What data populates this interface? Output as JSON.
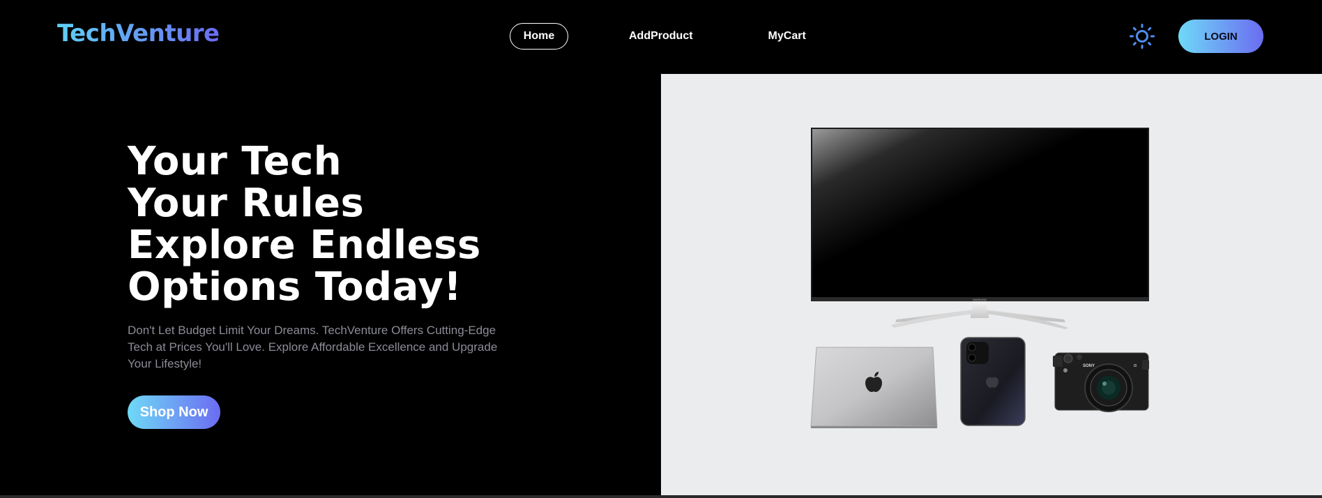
{
  "brand": {
    "logo_text": "TechVenture"
  },
  "nav": {
    "items": [
      {
        "label": "Home",
        "active": true
      },
      {
        "label": "AddProduct",
        "active": false
      },
      {
        "label": "MyCart",
        "active": false
      }
    ],
    "theme_toggle_icon": "sun-icon",
    "login_label": "LOGIN"
  },
  "hero": {
    "title_lines": [
      "Your Tech",
      "Your Rules",
      "Explore Endless",
      "Options Today!"
    ],
    "description": "Don't Let Budget Limit Your Dreams. TechVenture Offers Cutting-Edge Tech at Prices You'll Love. Explore Affordable Excellence and Upgrade Your Lifestyle!",
    "cta_label": "Shop Now",
    "image_brand_text": "SAMSUNG"
  },
  "colors": {
    "background": "#000000",
    "gradient_start": "#6fd9f7",
    "gradient_end": "#6b6cf1",
    "image_panel_bg": "#ebecee",
    "description_text": "#8c8c99"
  }
}
